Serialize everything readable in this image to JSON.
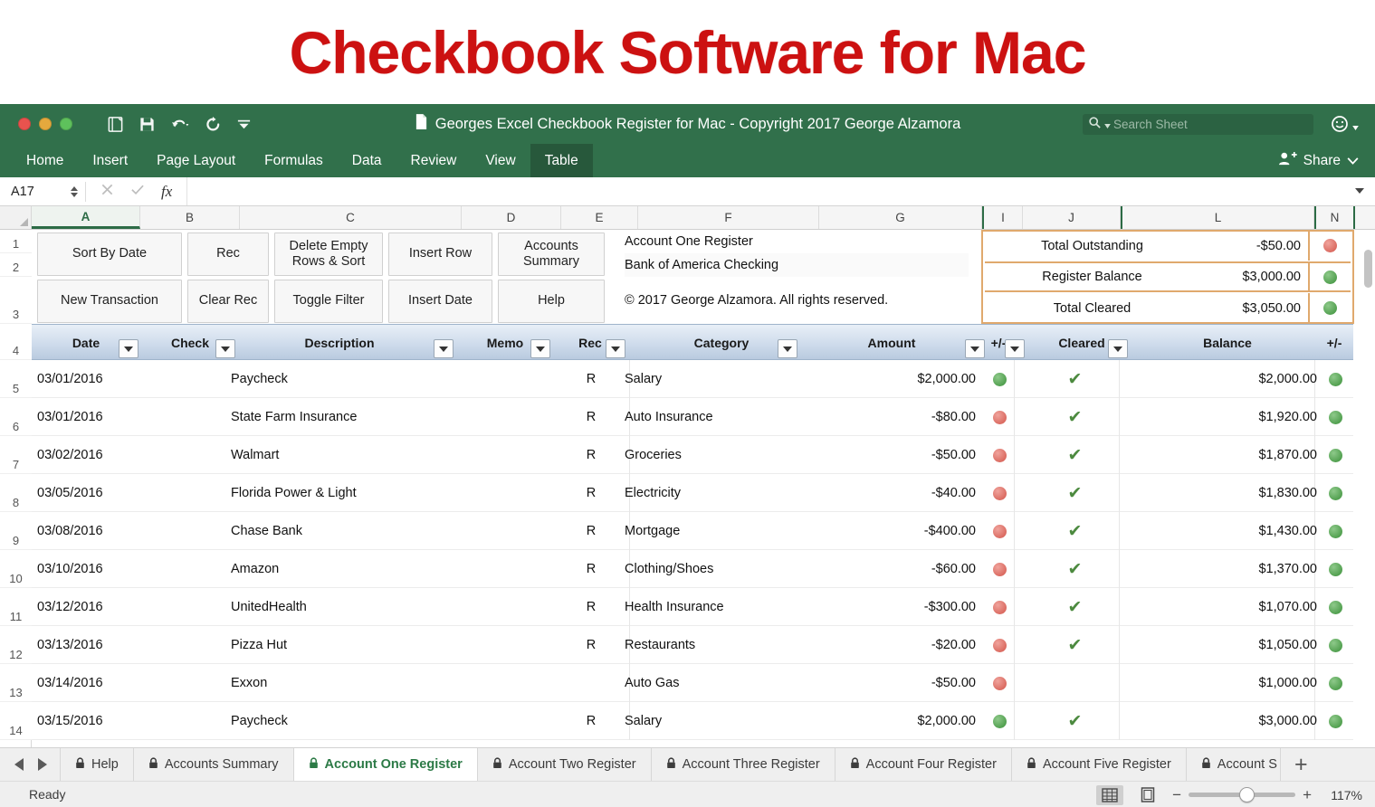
{
  "headline": "Checkbook Software for Mac",
  "window": {
    "document_title": "Georges Excel Checkbook Register for Mac - Copyright 2017 George Alzamora",
    "search_placeholder": "Search Sheet",
    "share_label": "Share",
    "ribbon_tabs": [
      {
        "label": "Home",
        "active": false
      },
      {
        "label": "Insert",
        "active": false
      },
      {
        "label": "Page Layout",
        "active": false
      },
      {
        "label": "Formulas",
        "active": false
      },
      {
        "label": "Data",
        "active": false
      },
      {
        "label": "Review",
        "active": false
      },
      {
        "label": "View",
        "active": false
      },
      {
        "label": "Table",
        "active": true
      }
    ]
  },
  "formula_bar": {
    "name_box": "A17",
    "formula": ""
  },
  "grid": {
    "column_headers": [
      "A",
      "B",
      "C",
      "D",
      "E",
      "F",
      "G",
      "I",
      "J",
      "L",
      "N"
    ],
    "row_numbers": [
      "1",
      "2",
      "3",
      "4",
      "5",
      "6",
      "7",
      "8",
      "9",
      "10",
      "11",
      "12",
      "13",
      "14"
    ],
    "selected_column": "A"
  },
  "macro_buttons": [
    {
      "label": "Sort By Date"
    },
    {
      "label": "Rec"
    },
    {
      "label": "Delete Empty Rows & Sort"
    },
    {
      "label": "Insert Row"
    },
    {
      "label": "Accounts Summary"
    },
    {
      "label": "New Transaction"
    },
    {
      "label": "Clear Rec"
    },
    {
      "label": "Toggle Filter"
    },
    {
      "label": "Insert Date"
    },
    {
      "label": "Help"
    }
  ],
  "account_info": {
    "register_name": "Account One Register",
    "bank_name": "Bank of America Checking",
    "copyright": "© 2017 George Alzamora.  All rights reserved."
  },
  "summary": {
    "border_color": "#e0a96d",
    "rows": [
      {
        "label": "Total Outstanding",
        "value": "-$50.00",
        "status": "red"
      },
      {
        "label": "Register Balance",
        "value": "$3,000.00",
        "status": "green"
      },
      {
        "label": "Total Cleared",
        "value": "$3,050.00",
        "status": "green"
      }
    ]
  },
  "table": {
    "headers": [
      "Date",
      "Check",
      "Description",
      "Memo",
      "Rec",
      "Category",
      "Amount",
      "+/-",
      "Cleared",
      "Balance",
      "+/-"
    ],
    "rows": [
      {
        "date": "03/01/2016",
        "check": "",
        "description": "Paycheck",
        "memo": "",
        "rec": "R",
        "category": "Salary",
        "amount": "$2,000.00",
        "amount_status": "green",
        "cleared": "✔",
        "balance": "$2,000.00",
        "balance_status": "green"
      },
      {
        "date": "03/01/2016",
        "check": "",
        "description": "State Farm Insurance",
        "memo": "",
        "rec": "R",
        "category": "Auto Insurance",
        "amount": "-$80.00",
        "amount_status": "red",
        "cleared": "✔",
        "balance": "$1,920.00",
        "balance_status": "green"
      },
      {
        "date": "03/02/2016",
        "check": "",
        "description": "Walmart",
        "memo": "",
        "rec": "R",
        "category": "Groceries",
        "amount": "-$50.00",
        "amount_status": "red",
        "cleared": "✔",
        "balance": "$1,870.00",
        "balance_status": "green"
      },
      {
        "date": "03/05/2016",
        "check": "",
        "description": "Florida Power & Light",
        "memo": "",
        "rec": "R",
        "category": "Electricity",
        "amount": "-$40.00",
        "amount_status": "red",
        "cleared": "✔",
        "balance": "$1,830.00",
        "balance_status": "green"
      },
      {
        "date": "03/08/2016",
        "check": "",
        "description": "Chase Bank",
        "memo": "",
        "rec": "R",
        "category": "Mortgage",
        "amount": "-$400.00",
        "amount_status": "red",
        "cleared": "✔",
        "balance": "$1,430.00",
        "balance_status": "green"
      },
      {
        "date": "03/10/2016",
        "check": "",
        "description": "Amazon",
        "memo": "",
        "rec": "R",
        "category": "Clothing/Shoes",
        "amount": "-$60.00",
        "amount_status": "red",
        "cleared": "✔",
        "balance": "$1,370.00",
        "balance_status": "green"
      },
      {
        "date": "03/12/2016",
        "check": "",
        "description": "UnitedHealth",
        "memo": "",
        "rec": "R",
        "category": "Health Insurance",
        "amount": "-$300.00",
        "amount_status": "red",
        "cleared": "✔",
        "balance": "$1,070.00",
        "balance_status": "green"
      },
      {
        "date": "03/13/2016",
        "check": "",
        "description": "Pizza Hut",
        "memo": "",
        "rec": "R",
        "category": "Restaurants",
        "amount": "-$20.00",
        "amount_status": "red",
        "cleared": "✔",
        "balance": "$1,050.00",
        "balance_status": "green"
      },
      {
        "date": "03/14/2016",
        "check": "",
        "description": "Exxon",
        "memo": "",
        "rec": "",
        "category": "Auto Gas",
        "amount": "-$50.00",
        "amount_status": "red",
        "cleared": "",
        "balance": "$1,000.00",
        "balance_status": "green"
      },
      {
        "date": "03/15/2016",
        "check": "",
        "description": "Paycheck",
        "memo": "",
        "rec": "R",
        "category": "Salary",
        "amount": "$2,000.00",
        "amount_status": "green",
        "cleared": "✔",
        "balance": "$3,000.00",
        "balance_status": "green"
      }
    ]
  },
  "sheet_tabs": [
    {
      "label": "Help",
      "active": false,
      "locked": true
    },
    {
      "label": "Accounts Summary",
      "active": false,
      "locked": true
    },
    {
      "label": "Account One Register",
      "active": true,
      "locked": true
    },
    {
      "label": "Account Two Register",
      "active": false,
      "locked": true
    },
    {
      "label": "Account Three Register",
      "active": false,
      "locked": true
    },
    {
      "label": "Account Four Register",
      "active": false,
      "locked": true
    },
    {
      "label": "Account Five Register",
      "active": false,
      "locked": true
    },
    {
      "label": "Account S",
      "active": false,
      "locked": true
    }
  ],
  "add_sheet_label": "+",
  "status": {
    "text": "Ready",
    "zoom": "117%",
    "zoom_minus": "−",
    "zoom_plus": "+"
  },
  "colors": {
    "ribbon_green": "#31704b",
    "accent_red": "#cc1111",
    "tab_active_green": "#2c7a46",
    "summary_border": "#e0a96d"
  }
}
